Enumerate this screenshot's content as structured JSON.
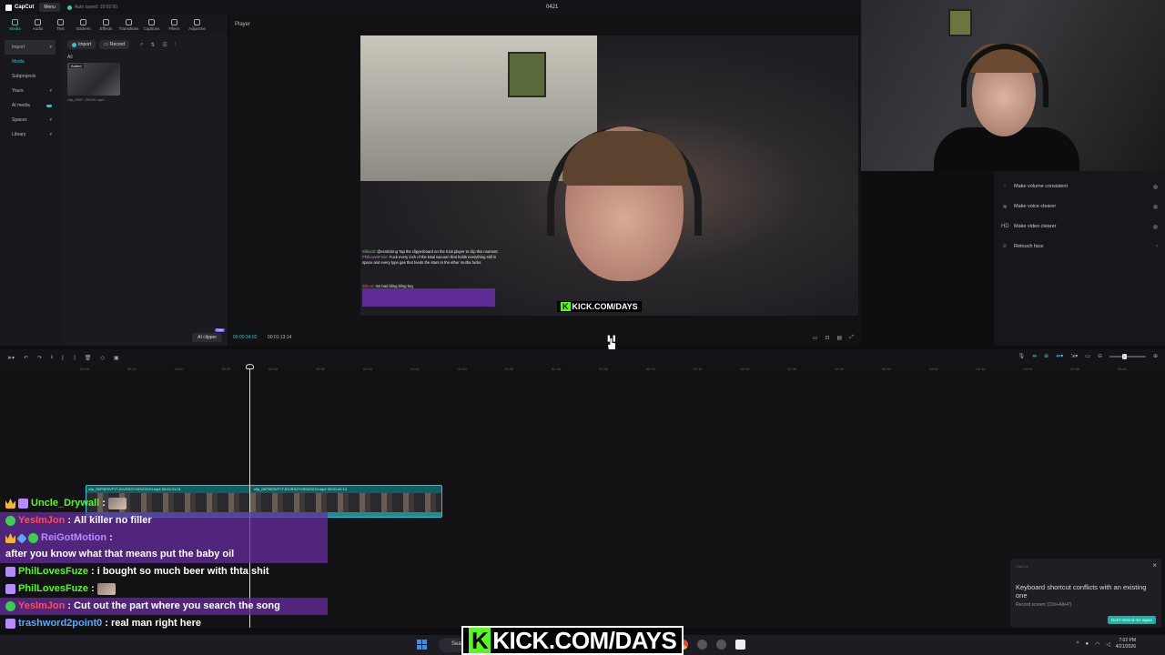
{
  "app": {
    "name": "CapCut",
    "menu_label": "Menu",
    "autosave": "Auto saved: 19:02:00",
    "project_title": "0421"
  },
  "toolbar": {
    "tools": [
      {
        "label": "Media",
        "icon": "media-icon",
        "active": true
      },
      {
        "label": "Audio",
        "icon": "audio-icon"
      },
      {
        "label": "Text",
        "icon": "text-icon"
      },
      {
        "label": "Stickers",
        "icon": "stickers-icon"
      },
      {
        "label": "Effects",
        "icon": "effects-icon"
      },
      {
        "label": "Transitions",
        "icon": "transitions-icon"
      },
      {
        "label": "Captions",
        "icon": "captions-icon"
      },
      {
        "label": "Filters",
        "icon": "filters-icon"
      },
      {
        "label": "Adjustme",
        "icon": "adjustment-icon"
      }
    ]
  },
  "leftnav": {
    "items": [
      "Import",
      "Media",
      "Subprojects",
      "Yours",
      "AI media",
      "Spaces",
      "Library"
    ]
  },
  "mediapanel": {
    "import_label": "Import",
    "record_label": "Record",
    "filter_label": "All",
    "clip_badge": "Added",
    "clip_name": "clip_0IKP...Z9GHI.mp4",
    "ai_clipper_label": "AI clipper",
    "ai_clipper_badge": "Free"
  },
  "player": {
    "label": "Player",
    "current_time": "00:00:34:02",
    "total_time": "00:01:13:14",
    "pause_icon": "pause-icon",
    "kick_tag": "KICK.COM/DAYS",
    "chat_overlay": [
      {
        "user": "Bifkoob",
        "text": "@ecsticking Tap the clipperboard on the Kick player to clip this moment."
      },
      {
        "user": "PhilLovesFuze",
        "text": "Fuck every inch of the total vacuum that holds everything still in space and every type gas that feeds the stars in the ether mutha fucks"
      },
      {
        "user": "Iltikoor",
        "text": "ms bad bling bling boy"
      }
    ]
  },
  "enhance": {
    "items": [
      {
        "label": "Make volume consistent",
        "icon": "volume-icon"
      },
      {
        "label": "Make voice clearer",
        "icon": "voice-icon"
      },
      {
        "label": "Make video clearer",
        "icon": "hd-icon"
      },
      {
        "label": "Retouch face",
        "icon": "retouch-icon"
      }
    ]
  },
  "timeline": {
    "ruler_ticks": [
      "00:00",
      "00:10",
      "00:20",
      "00:30",
      "00:40",
      "00:50",
      "01:00",
      "01:10",
      "01:20",
      "01:30",
      "01:40",
      "01:50",
      "02:00",
      "02:10",
      "02:20",
      "02:30",
      "02:40",
      "02:50",
      "03:00",
      "03:10",
      "03:20",
      "03:30",
      "03:40"
    ],
    "clips": [
      {
        "name": "clip_0KP0E9VFYTJDVRSZYV9SZ9GHI.mp4",
        "duration": "00:00:31:01"
      },
      {
        "name": "clip_0KP0E9VFYTJDVRSZYV9SZ9GHI.mp4",
        "duration": "00:00:42:13"
      }
    ]
  },
  "chat": [
    {
      "user": "Uncle_Drywall",
      "user_color": "#53fc18",
      "badges": [
        "crown",
        "sub"
      ],
      "text": "",
      "emote": true
    },
    {
      "user": "YesImJon",
      "user_color": "#ff4d4d",
      "badges": [
        "check"
      ],
      "text": "All killer no filler",
      "highlight": true
    },
    {
      "user": "ReiGotMotion",
      "user_color": "#b48cff",
      "badges": [
        "crown",
        "sword",
        "check"
      ],
      "text": "after you know what that means put the baby oil",
      "highlight": true
    },
    {
      "user": "PhilLovesFuze",
      "user_color": "#53fc18",
      "badges": [
        "sub"
      ],
      "text": "i bought so much beer with thta shit"
    },
    {
      "user": "PhilLovesFuze",
      "user_color": "#53fc18",
      "badges": [
        "sub"
      ],
      "text": "",
      "emote": true
    },
    {
      "user": "YesImJon",
      "user_color": "#ff4d4d",
      "badges": [
        "check"
      ],
      "text": "Cut out the part where you search the song",
      "highlight": true
    },
    {
      "user": "trashword2point0",
      "user_color": "#5aa8ff",
      "badges": [
        "sub"
      ],
      "text": "real man right here"
    }
  ],
  "toast": {
    "app": "CapCut",
    "title": "Keyboard shortcut conflicts with an existing one",
    "subtitle": "Record screen: [Ctrl+Alt+P]",
    "button": "Don't remind me again"
  },
  "taskbar": {
    "search": "Search",
    "kick_banner": "KICK.COM/DAYS",
    "time": "7:02 PM",
    "date": "4/21/2026"
  },
  "colors": {
    "accent": "#2ec6d6",
    "kick_green": "#53fc18",
    "highlight_purple": "#682ca0"
  }
}
